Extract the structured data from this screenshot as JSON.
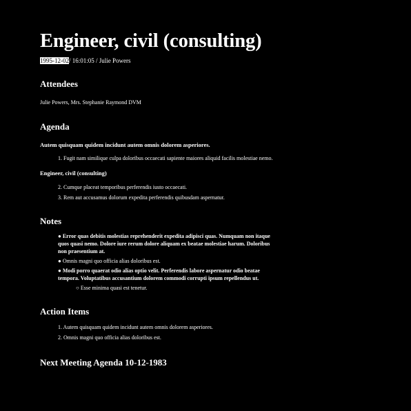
{
  "title": "Engineer, civil (consulting)",
  "meta": {
    "date": "1995-12-02",
    "rest": "/ 16:01:05 / Julie Powers"
  },
  "attendees": {
    "heading": "Attendees",
    "text": "Julie Powers, Mrs. Stephanie Raymond DVM"
  },
  "agenda": {
    "heading": "Agenda",
    "sections": [
      {
        "title": "Autem quisquam quidem incidunt autem omnis dolorem asperiores.",
        "items": [
          "1. Fugit nam similique culpa doloribus occaecati sapiente maiores aliquid facilis molestiae nemo."
        ]
      },
      {
        "title": "Engineer, civil (consulting)",
        "items": [
          "2. Cumque placeat temporibus perferendis iusto occaecati.",
          "3. Rem aut accusamus dolorum expedita perferendis quibusdam aspernatur."
        ]
      }
    ]
  },
  "notes": {
    "heading": "Notes",
    "items": [
      "● Error quas debitis molestias reprehenderit expedita adipisci quas. Numquam non itaque quos quasi nemo. Dolore iure rerum dolore aliquam ex beatae molestiae harum. Doloribus non praesentium at.",
      "● Omnis magni quo officia alias doloribus est.",
      "● Modi porro quaerat odio alias optio velit. Perferendis labore aspernatur odio beatae tempora. Voluptatibus accusantium dolorem commodi corrupti ipsum repellendus ut."
    ],
    "subitem": "○ Esse minima quasi est tenetur."
  },
  "action_items": {
    "heading": "Action Items",
    "items": [
      "1. Autem quisquam quidem incidunt autem omnis dolorem asperiores.",
      "2. Omnis magni quo officia alias doloribus est."
    ]
  },
  "next_meeting": {
    "heading": "Next Meeting Agenda 10-12-1983"
  }
}
